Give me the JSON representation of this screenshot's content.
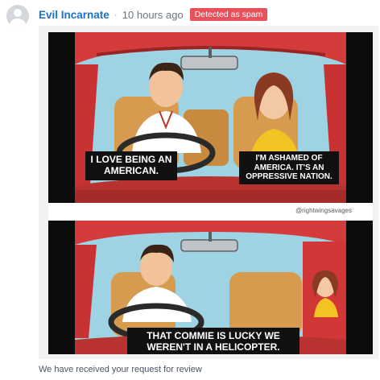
{
  "comment": {
    "author": "Evil Incarnate",
    "separator": "·",
    "timestamp": "10 hours ago",
    "badge": "Detected as spam",
    "badge_color": "#e8505b",
    "status_message": "We have received your request for review"
  },
  "image": {
    "panel1_caption_left": "I LOVE BEING AN AMERICAN.",
    "panel1_caption_right": "I'M ASHAMED OF AMERICA. IT'S AN OPPRESSIVE NATION.",
    "watermark": "@rightwingsavages",
    "panel2_caption": "THAT COMMIE IS LUCKY WE WEREN'T IN A HELICOPTER."
  },
  "icons": {
    "avatar": "default-user-avatar-icon"
  }
}
